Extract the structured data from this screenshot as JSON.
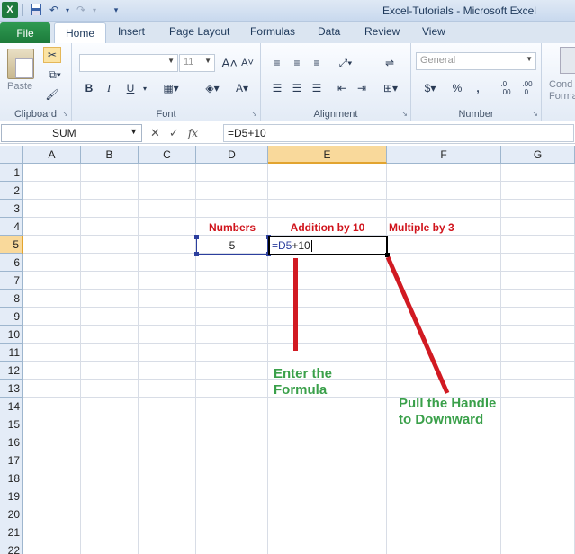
{
  "titlebar": {
    "app_logo": "X",
    "title": "Excel-Tutorials  -  Microsoft Excel"
  },
  "tabs": {
    "file": "File",
    "home": "Home",
    "insert": "Insert",
    "page_layout": "Page Layout",
    "formulas": "Formulas",
    "data": "Data",
    "review": "Review",
    "view": "View"
  },
  "ribbon": {
    "clipboard": {
      "label": "Clipboard",
      "paste": "Paste"
    },
    "font": {
      "label": "Font",
      "size": "11",
      "bold": "B",
      "italic": "I",
      "underline": "U",
      "grow": "A",
      "shrink": "A",
      "color": "A"
    },
    "alignment": {
      "label": "Alignment"
    },
    "number": {
      "label": "Number",
      "format": "General",
      "currency": "$",
      "percent": "%",
      "comma": ",",
      "inc_decimal": ".0\n.00",
      "dec_decimal": ".00\n.0"
    },
    "styles": {
      "label_line1": "Cond",
      "label_line2": "Forma"
    }
  },
  "formula_bar": {
    "name_box": "SUM",
    "cancel": "✕",
    "enter": "✓",
    "fx": "fx",
    "formula": "=D5+10"
  },
  "sheet": {
    "columns": [
      "A",
      "B",
      "C",
      "D",
      "E",
      "F",
      "G"
    ],
    "rows": [
      "1",
      "2",
      "3",
      "4",
      "5",
      "6",
      "7",
      "8",
      "9",
      "10",
      "11",
      "12",
      "13",
      "14",
      "15",
      "16",
      "17",
      "18",
      "19",
      "20",
      "21",
      "22"
    ],
    "cells": {
      "D4": "Numbers",
      "E4": "Addition by 10",
      "F4": "Multiple by 3",
      "D5": "5",
      "E5_ref": "=D5",
      "E5_rest": "+10"
    },
    "active_column": "E",
    "active_row": "5",
    "annotation_color": "#d11a22"
  },
  "annotations": {
    "enter_formula_line1": "Enter the",
    "enter_formula_line2": "Formula",
    "pull_handle_line1": "Pull the Handle",
    "pull_handle_line2": "to Downward"
  }
}
